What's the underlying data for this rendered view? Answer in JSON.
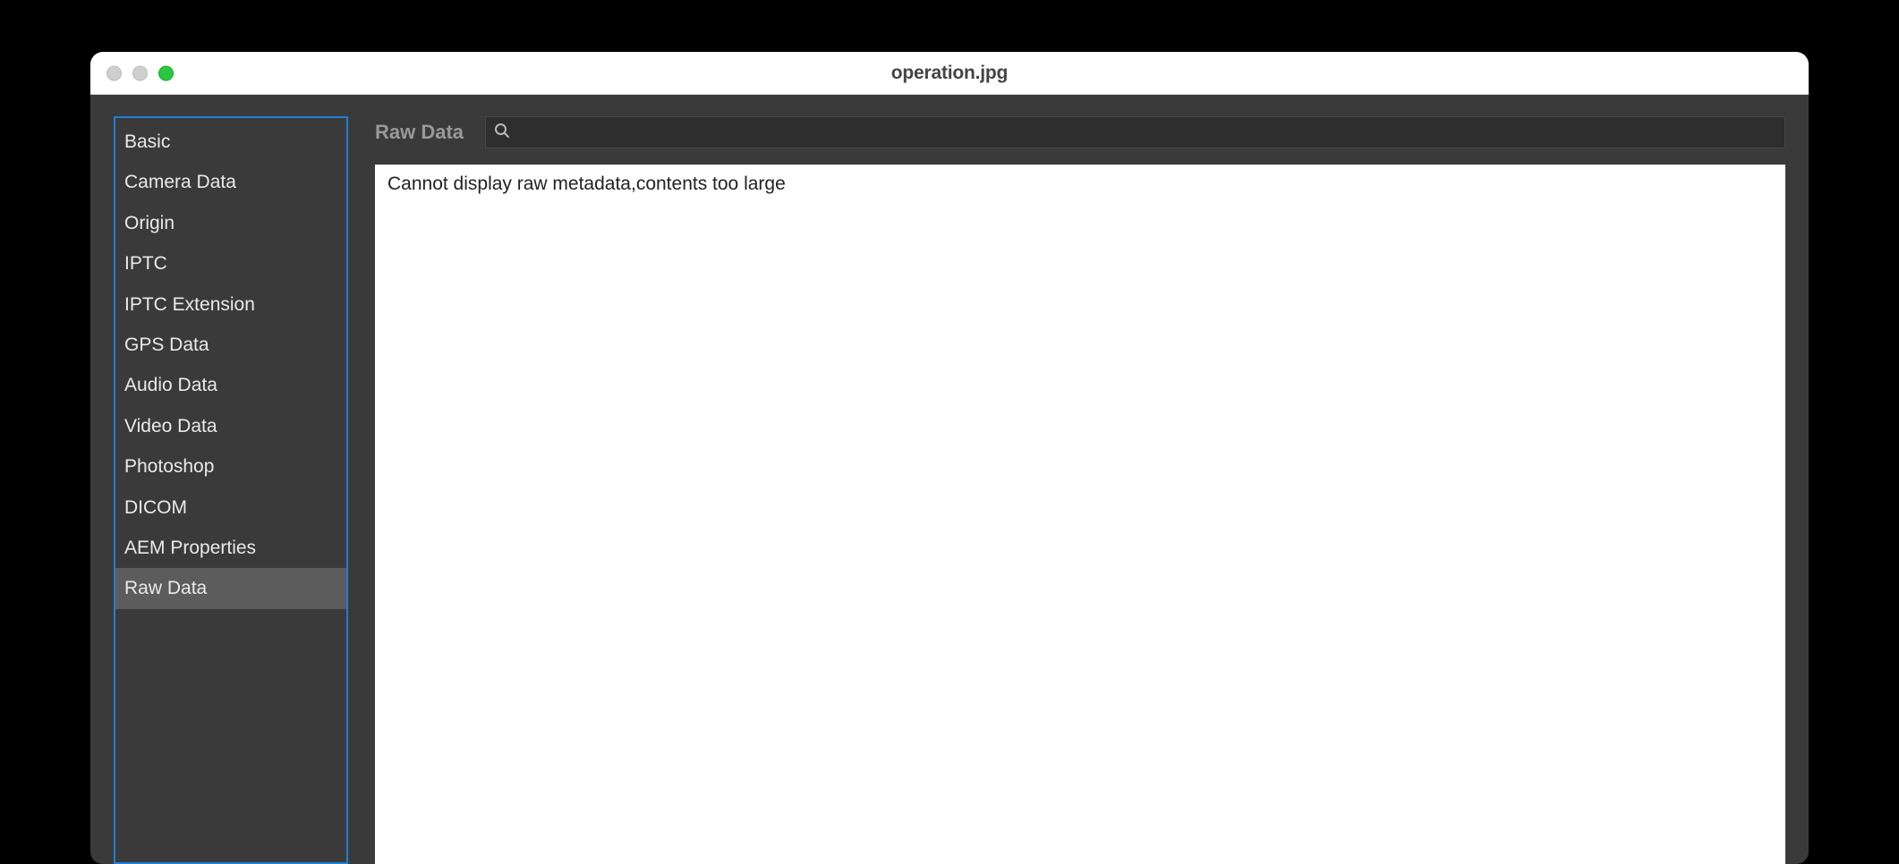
{
  "window": {
    "title": "operation.jpg"
  },
  "sidebar": {
    "items": [
      {
        "label": "Basic",
        "selected": false
      },
      {
        "label": "Camera Data",
        "selected": false
      },
      {
        "label": "Origin",
        "selected": false
      },
      {
        "label": "IPTC",
        "selected": false
      },
      {
        "label": "IPTC Extension",
        "selected": false
      },
      {
        "label": "GPS Data",
        "selected": false
      },
      {
        "label": "Audio Data",
        "selected": false
      },
      {
        "label": "Video Data",
        "selected": false
      },
      {
        "label": "Photoshop",
        "selected": false
      },
      {
        "label": "DICOM",
        "selected": false
      },
      {
        "label": "AEM Properties",
        "selected": false
      },
      {
        "label": "Raw Data",
        "selected": true
      }
    ]
  },
  "main": {
    "section_label": "Raw Data",
    "search_placeholder": "",
    "panel_message": "Cannot display raw metadata,contents too large"
  }
}
